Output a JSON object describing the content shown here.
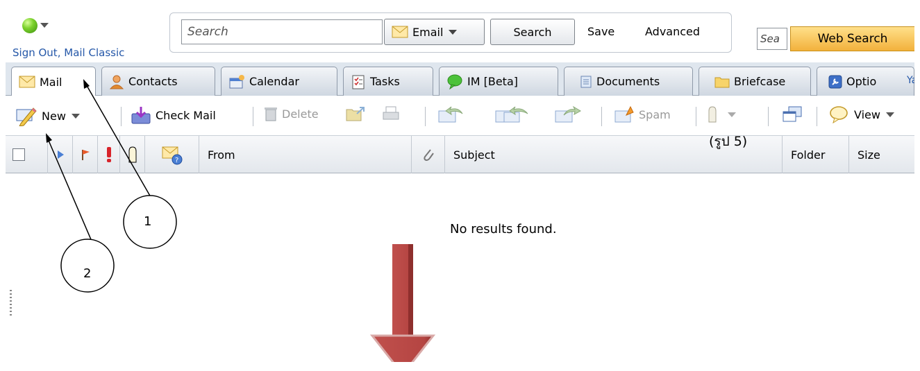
{
  "header": {
    "sign_out_label": "Sign Out",
    "separator": ",",
    "mail_classic_label": "Mail Classic",
    "search_placeholder": "Search",
    "email_scope_label": "Email",
    "search_button": "Search",
    "save_link": "Save",
    "advanced_link": "Advanced",
    "web_search_placeholder": "Sea",
    "web_search_button": "Web Search"
  },
  "tabs": [
    {
      "label": "Mail",
      "icon": "envelope-icon"
    },
    {
      "label": "Contacts",
      "icon": "contacts-icon"
    },
    {
      "label": "Calendar",
      "icon": "calendar-icon"
    },
    {
      "label": "Tasks",
      "icon": "tasks-icon"
    },
    {
      "label": "IM [Beta]",
      "icon": "chat-bubble-icon"
    },
    {
      "label": "Documents",
      "icon": "document-icon"
    },
    {
      "label": "Briefcase",
      "icon": "folder-icon"
    },
    {
      "label": "Optio",
      "icon": "options-icon"
    }
  ],
  "tabs_overflow_text": "Yah",
  "toolbar": {
    "new_label": "New",
    "check_mail_label": "Check Mail",
    "delete_label": "Delete",
    "spam_label": "Spam",
    "view_label": "View"
  },
  "columns": {
    "from": "From",
    "subject": "Subject",
    "folder": "Folder",
    "size": "Size"
  },
  "empty_message": "No results found.",
  "caption": "(รูป 5)",
  "annotations": {
    "callout_1": "1",
    "callout_2": "2"
  },
  "colors": {
    "status_online": "#7bd12c",
    "link_blue": "#2457a8",
    "web_search_orange": "#f2b13c",
    "arrow_red": "#c0504d"
  }
}
